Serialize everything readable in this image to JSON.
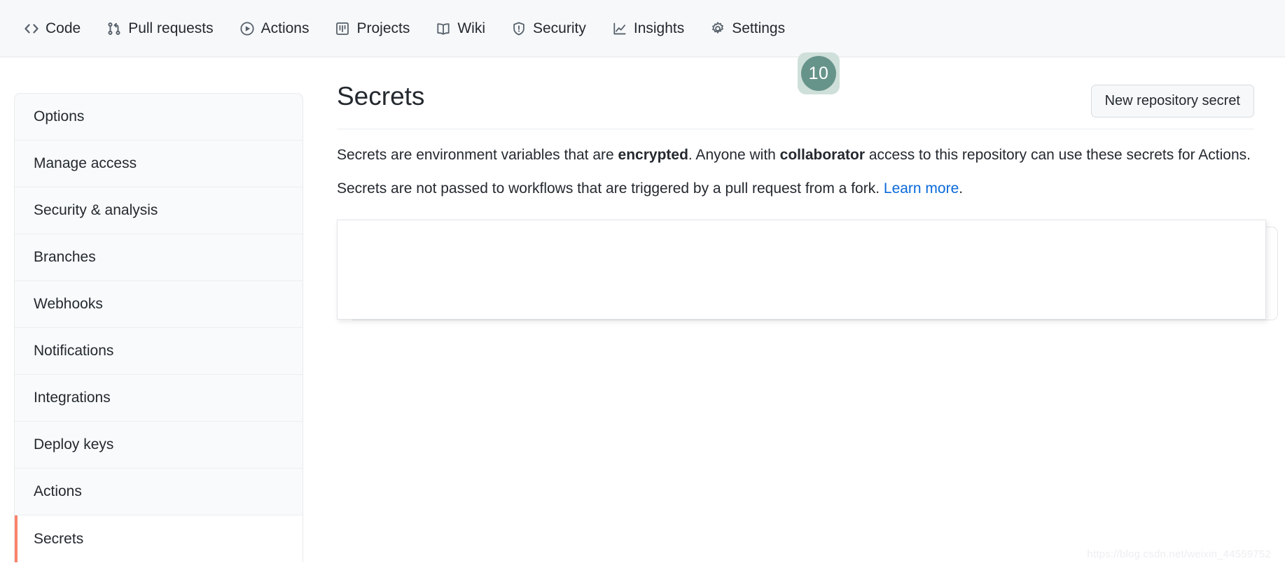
{
  "repo_nav": {
    "items": [
      {
        "label": "Code",
        "icon": "code-icon"
      },
      {
        "label": "Pull requests",
        "icon": "git-pull-request-icon"
      },
      {
        "label": "Actions",
        "icon": "play-circle-icon"
      },
      {
        "label": "Projects",
        "icon": "project-board-icon"
      },
      {
        "label": "Wiki",
        "icon": "book-icon"
      },
      {
        "label": "Security",
        "icon": "shield-alert-icon"
      },
      {
        "label": "Insights",
        "icon": "graph-line-icon"
      },
      {
        "label": "Settings",
        "icon": "gear-icon"
      }
    ]
  },
  "badge": {
    "value": "10",
    "circle_color": "#67948a",
    "background_color": "#cfdfd9"
  },
  "sidebar": {
    "items": [
      {
        "label": "Options",
        "selected": false
      },
      {
        "label": "Manage access",
        "selected": false
      },
      {
        "label": "Security & analysis",
        "selected": false
      },
      {
        "label": "Branches",
        "selected": false
      },
      {
        "label": "Webhooks",
        "selected": false
      },
      {
        "label": "Notifications",
        "selected": false
      },
      {
        "label": "Integrations",
        "selected": false
      },
      {
        "label": "Deploy keys",
        "selected": false
      },
      {
        "label": "Actions",
        "selected": false
      },
      {
        "label": "Secrets",
        "selected": true
      }
    ],
    "selected_accent_color": "#f9826c"
  },
  "main": {
    "title": "Secrets",
    "new_secret_button": "New repository secret",
    "paragraph1": {
      "part1": "Secrets are environment variables that are ",
      "bold1": "encrypted",
      "part2": ". Anyone with ",
      "bold2": "collaborator",
      "part3": " access to this repository can use these secrets for Actions."
    },
    "paragraph2": {
      "text": "Secrets are not passed to workflows that are triggered by a pull request from a fork. ",
      "link_label": "Learn more",
      "suffix": ".",
      "link_color": "#0969da"
    }
  },
  "watermark": {
    "text": "https://blog.csdn.net/weixin_44559752"
  }
}
